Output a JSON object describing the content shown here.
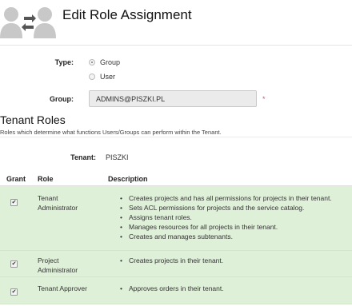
{
  "header": {
    "title": "Edit Role Assignment",
    "icon": "users-swap-icon"
  },
  "form": {
    "type_label": "Type:",
    "type_options": [
      {
        "label": "Group",
        "selected": true
      },
      {
        "label": "User",
        "selected": false
      }
    ],
    "group_label": "Group:",
    "group_value": "ADMINS@PISZKI.PL",
    "required_marker": "*"
  },
  "section": {
    "title": "Tenant Roles",
    "description": "Roles which determine what functions Users/Groups can perform within the Tenant."
  },
  "tenant": {
    "label": "Tenant:",
    "value": "PISZKI"
  },
  "table": {
    "columns": [
      "Grant",
      "Role",
      "Description"
    ],
    "rows": [
      {
        "granted": true,
        "role": "Tenant Administrator",
        "description": [
          "Creates projects and has all permissions for projects in their tenant.",
          "Sets ACL permissions for projects and the service catalog.",
          "Assigns tenant roles.",
          "Manages resources for all projects in their tenant.",
          "Creates and manages subtenants."
        ]
      },
      {
        "granted": true,
        "role": "Project Administrator",
        "description": [
          "Creates projects in their tenant."
        ]
      },
      {
        "granted": true,
        "role": "Tenant Approver",
        "description": [
          "Approves orders in their tenant."
        ]
      }
    ]
  }
}
